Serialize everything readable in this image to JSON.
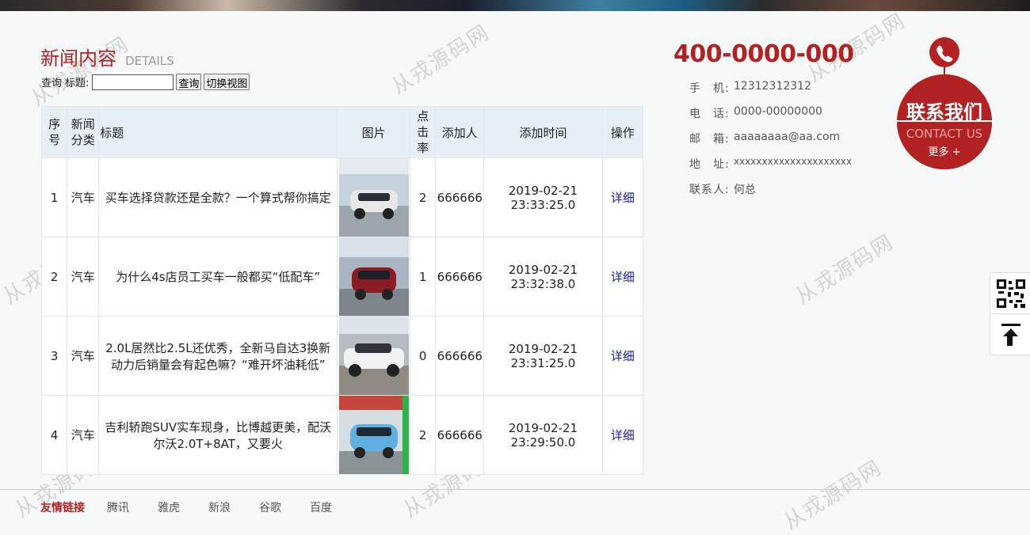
{
  "watermark_text": "从戎源码网",
  "header": {
    "title": "新闻内容",
    "subtitle": "DETAILS"
  },
  "search": {
    "query_label": "查询",
    "title_label": "标题:",
    "input_value": "",
    "search_button": "查询",
    "toggle_button": "切换视图"
  },
  "table": {
    "headers": {
      "no": "序号",
      "category": "新闻分类",
      "title": "标题",
      "image": "图片",
      "clicks": "点击率",
      "author": "添加人",
      "time": "添加时间",
      "action": "操作"
    },
    "rows": [
      {
        "no": "1",
        "category": "汽车",
        "title": "买车选择贷款还是全款？一个算式帮你搞定",
        "clicks": "2",
        "author": "666666",
        "date": "2019-02-21",
        "time": "23:33:25.0",
        "action": "详细",
        "car_color": "#e8e8e8"
      },
      {
        "no": "2",
        "category": "汽车",
        "title": "为什么4s店员工买车一般都买“低配车”",
        "clicks": "1",
        "author": "666666",
        "date": "2019-02-21",
        "time": "23:32:38.0",
        "action": "详细",
        "car_color": "#8b1b24"
      },
      {
        "no": "3",
        "category": "汽车",
        "title": "2.0L居然比2.5L还优秀，全新马自达3换新动力后销量会有起色嘛？“难开坏油耗低”",
        "clicks": "0",
        "author": "666666",
        "date": "2019-02-21",
        "time": "23:31:25.0",
        "action": "详细",
        "car_color": "#f2f2f2"
      },
      {
        "no": "4",
        "category": "汽车",
        "title": "吉利轿跑SUV实车现身，比博越更美，配沃尔沃2.0T+8AT，又要火",
        "clicks": "2",
        "author": "666666",
        "date": "2019-02-21",
        "time": "23:29:50.0",
        "action": "详细",
        "car_color": "#5fb0e0"
      }
    ]
  },
  "contact": {
    "hotline": "400-0000-000",
    "mobile_label": "手　机:",
    "mobile": "12312312312",
    "phone_label": "电　话:",
    "phone": "0000-00000000",
    "email_label": "邮　箱:",
    "email": "aaaaaaaa@aa.com",
    "address_label": "地　址:",
    "address": "xxxxxxxxxxxxxxxxxxxxx",
    "person_label": "联系人:",
    "person": "何总",
    "badge_cn": "联系我们",
    "badge_en": "CONTACT US",
    "badge_more": "更多 +"
  },
  "footer": {
    "friend_links_label": "友情链接",
    "links": [
      "腾讯",
      "雅虎",
      "新浪",
      "谷歌",
      "百度"
    ]
  },
  "colors": {
    "accent": "#b22222",
    "link": "#1a1aa6",
    "header_bg": "#e8eef6"
  }
}
